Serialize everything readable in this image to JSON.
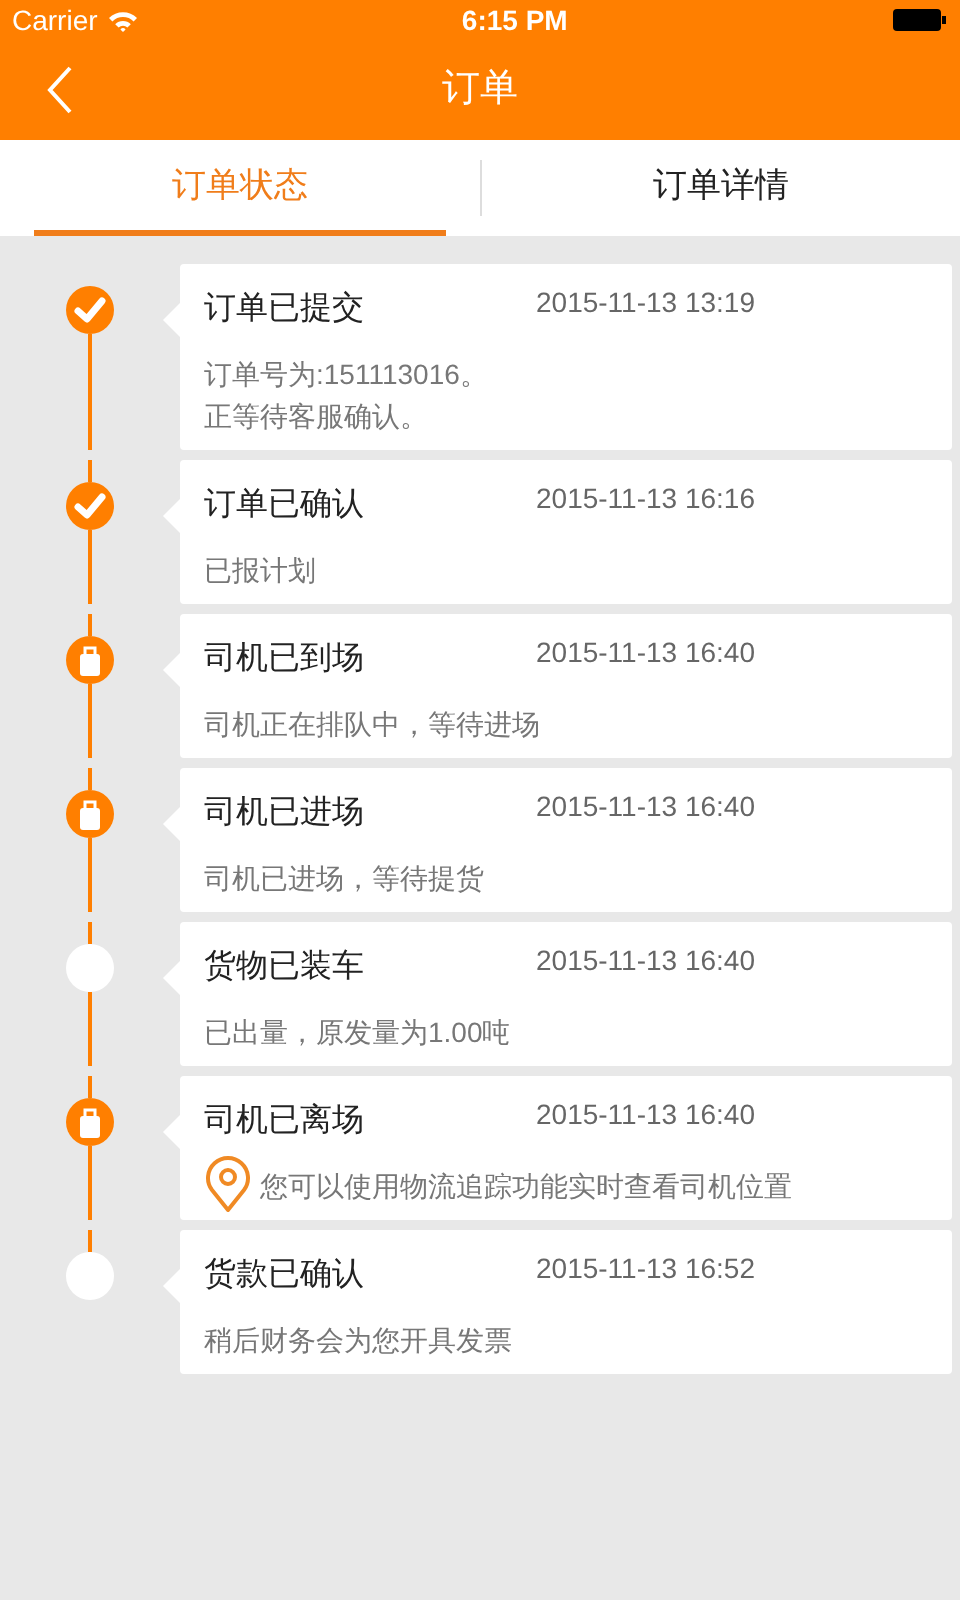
{
  "status_bar": {
    "carrier": "Carrier",
    "time": "6:15 PM"
  },
  "nav": {
    "title": "订单"
  },
  "tabs": [
    {
      "label": "订单状态",
      "selected": true
    },
    {
      "label": "订单详情",
      "selected": false
    }
  ],
  "timeline": [
    {
      "kind": "check",
      "title": "订单已提交",
      "time": "2015-11-13 13:19",
      "details": [
        "订单号为:151113016。",
        "正等待客服确认。"
      ],
      "pin": false
    },
    {
      "kind": "check",
      "title": "订单已确认",
      "time": "2015-11-13 16:16",
      "details": [
        "已报计划"
      ],
      "pin": false
    },
    {
      "kind": "door",
      "title": "司机已到场",
      "time": "2015-11-13 16:40",
      "details": [
        "司机正在排队中，等待进场"
      ],
      "pin": false
    },
    {
      "kind": "door",
      "title": "司机已进场",
      "time": "2015-11-13 16:40",
      "details": [
        "司机已进场，等待提货"
      ],
      "pin": false
    },
    {
      "kind": "plain",
      "title": "货物已装车",
      "time": "2015-11-13 16:40",
      "details": [
        "已出量，原发量为1.00吨"
      ],
      "pin": false
    },
    {
      "kind": "door",
      "title": "司机已离场",
      "time": "2015-11-13 16:40",
      "details": [
        "您可以使用物流追踪功能实时查看司机位置"
      ],
      "pin": true
    },
    {
      "kind": "plain",
      "title": "货款已确认",
      "time": "2015-11-13 16:52",
      "details": [
        "稍后财务会为您开具发票"
      ],
      "pin": false
    }
  ]
}
